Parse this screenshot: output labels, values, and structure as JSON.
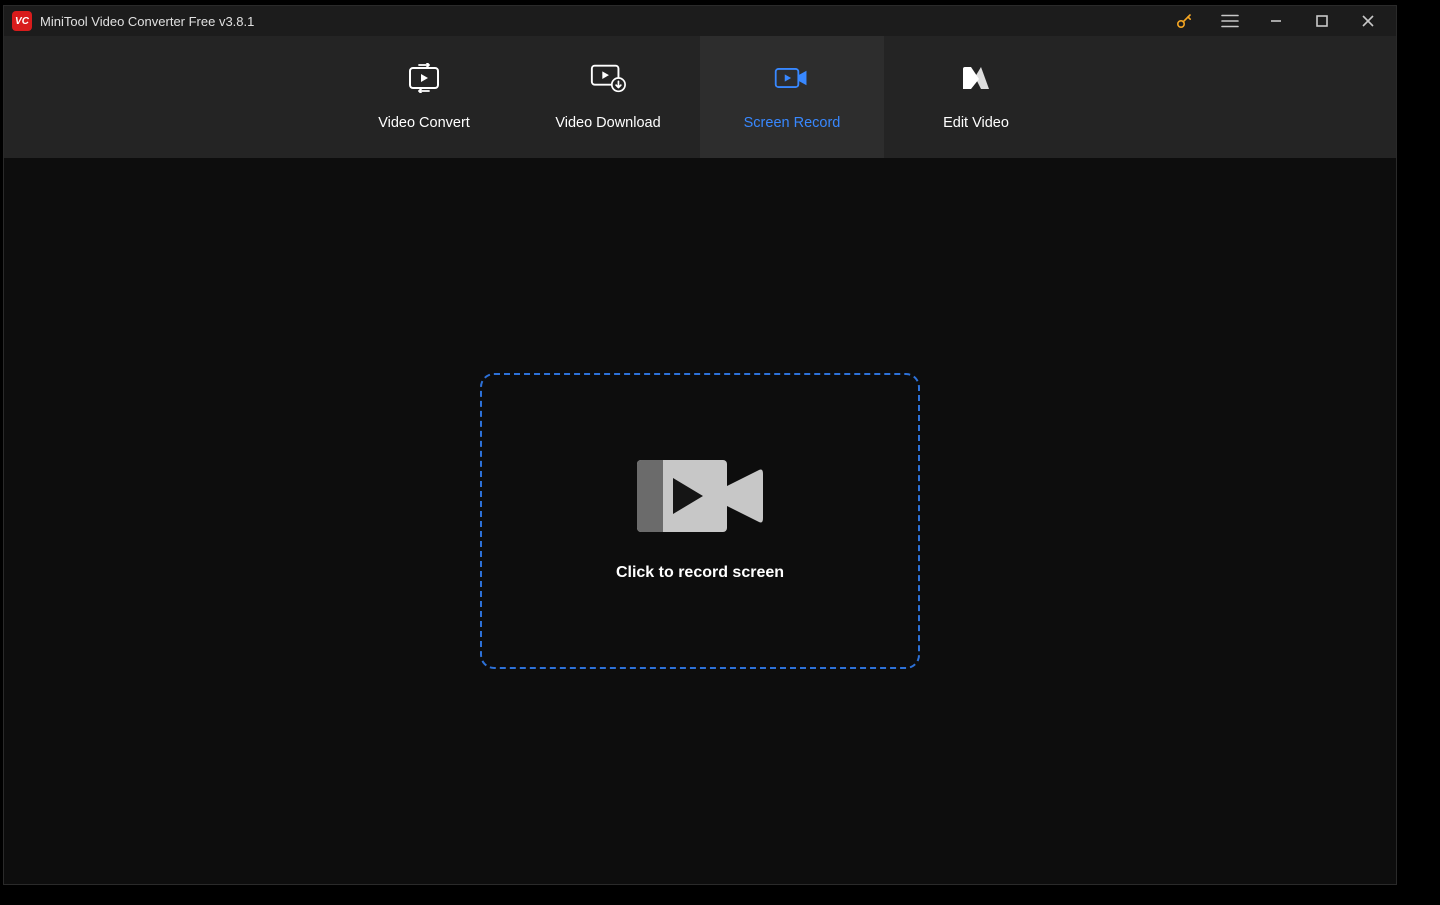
{
  "titlebar": {
    "app_icon_text": "VC",
    "title": "MiniTool Video Converter Free v3.8.1"
  },
  "tabs": {
    "convert": "Video Convert",
    "download": "Video Download",
    "record": "Screen Record",
    "edit": "Edit Video"
  },
  "main": {
    "record_cta": "Click to record screen"
  },
  "colors": {
    "accent": "#3888ff",
    "border_dashed": "#2d71d8",
    "bg_dark": "#0d0d0d",
    "bg_tabs": "#242424",
    "bg_tab_active": "#2d2d2d"
  }
}
